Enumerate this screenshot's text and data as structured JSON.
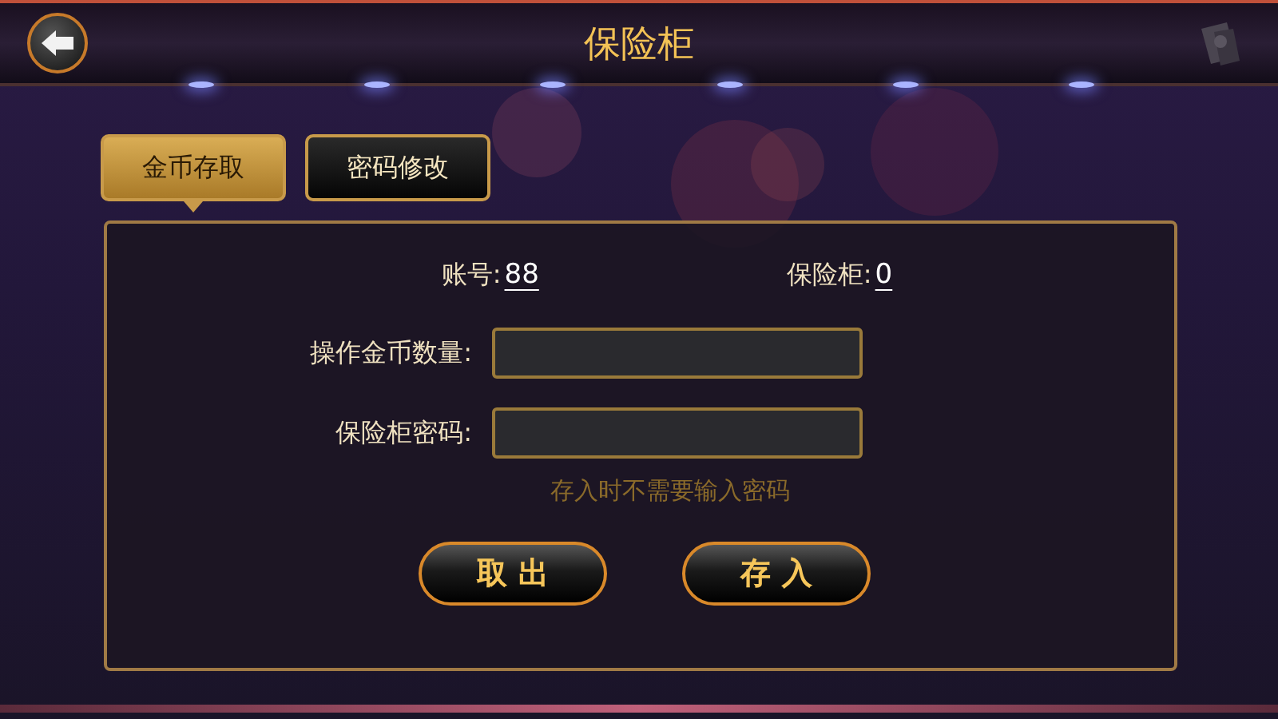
{
  "header": {
    "title": "保险柜"
  },
  "tabs": [
    {
      "label": "金币存取",
      "selected": true
    },
    {
      "label": "密码修改",
      "selected": false
    }
  ],
  "account": {
    "label": "账号:",
    "value": "88"
  },
  "safe": {
    "label": "保险柜:",
    "value": "0"
  },
  "fields": [
    {
      "label": "操作金币数量:"
    },
    {
      "label": "保险柜密码:"
    }
  ],
  "hint": "存入时不需要输入密码",
  "buttons": [
    "取 出",
    "存 入"
  ]
}
